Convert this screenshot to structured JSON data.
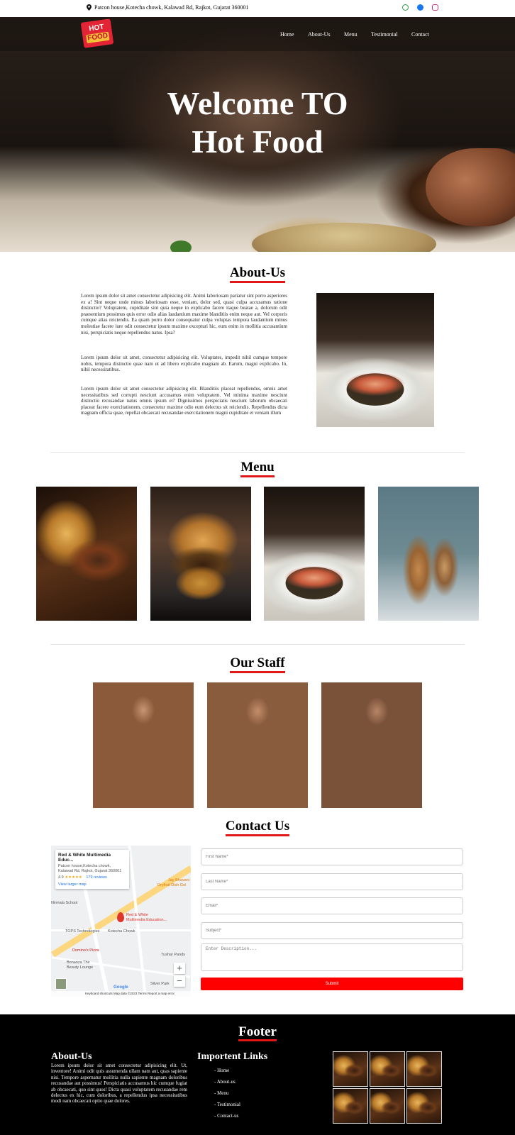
{
  "topbar": {
    "address": "Patcon house,Kotecha chowk, Kalawad Rd, Rajkot, Gujarat 360001",
    "socials": [
      {
        "icon": "whatsapp-icon",
        "color": "#25a244"
      },
      {
        "icon": "facebook-icon",
        "color": "#1877f2"
      },
      {
        "icon": "instagram-icon",
        "color": "#c13584"
      }
    ]
  },
  "nav": {
    "logo_line1": "HOT",
    "logo_line2": "FOOD",
    "items": [
      "Home",
      "About-Us",
      "Menu",
      "Testimonial",
      "Contact"
    ]
  },
  "hero": {
    "line1": "Welcome TO",
    "line2": "Hot Food"
  },
  "about": {
    "title": "About-Us",
    "paragraphs": [
      "Lorem ipsum dolor sit amet consectetur adipisicing elit. Animi laboriosam pariatur sint porro asperiores ex a! Sint neque unde minus laboriosam esse, veniam, dolor sed, quasi culpa accusamus ratione distinctio? Voluptatem, cupiditate sint quia neque in explicabo facere itaque beatae a, dolorum odit praesentium possimus quis error odio alias laudantium maxime blanditiis enim neque aut. Vel corporis cumque alias reiciendis. Ea quam porro dolor consequatur culpa voluptas tempora laudantium minus molestiae facere iure odit consectetur ipsum maxime excepturi hic, eum enim in mollitia accusantium nisi, perspiciatis neque repellendus natus. Ipsa?",
      "Lorem ipsum dolor sit amet, consectetur adipisicing elit. Voluptates, impedit nihil cumque tempore nobis, tempora distinctio quae nam ut ad libero explicabo magnam ab. Earum, magni explicabo. In, nihil necessitatibus.",
      "Lorem ipsum dolor sit amet consectetur adipisicing elit. Blanditiis placeat repellendus, omnis amet necessitatibus sed corrupti nesciunt accusamus enim voluptatem. Vel minima maxime nesciunt distinctio recusandae natus omnis ipsum et? Dignissimos perspiciatis nesciunt laborum obcaecati placeat facere exercitationem, consectetur maxime odio eum delectus sit reiciendis. Repellendus dicta magnam officia quae, repellat obcaecati recusandae exercitationem magni cupiditate et veniam illum"
    ]
  },
  "menu": {
    "title": "Menu"
  },
  "staff": {
    "title": "Our Staff"
  },
  "contact": {
    "title": "Contact Us",
    "map": {
      "place_name": "Red & White Multimedia Educ...",
      "place_addr1": "Patcon house,Kotecha chowk,",
      "place_addr2": "Kalawad Rd, Rajkot, Gujarat 360001",
      "rating": "4.9",
      "stars": "★★★★★",
      "reviews": "179 reviews",
      "larger_map": "View larger map",
      "pin_label1": "Red & White",
      "pin_label2": "Multimedia Education...",
      "labels": [
        "TOPS Technologies",
        "Domino's Pizza",
        "Bonanza The",
        "Beauty Lounge",
        "Tushar Pandy",
        "Jay Bhavani",
        "Dryfruit Dish Gol",
        "Kotecha Chowk",
        "Nirmala School",
        "Silver Park"
      ],
      "zoom_in": "+",
      "zoom_out": "−",
      "google": "Google",
      "footer_text": "Keyboard shortcuts    Map data ©2023    Terms    Report a map error"
    },
    "first_name_placeholder": "First Name*",
    "last_name_placeholder": "Last Name*",
    "email_placeholder": "Email*",
    "subject_placeholder": "Subject*",
    "description_placeholder": "Enter Description...",
    "submit_label": "Submit"
  },
  "footer": {
    "title": "Footer",
    "about_title": "About-Us",
    "about_text": "Lorem ipsum dolor sit amet consectetur adipisicing elit. Ut, inventore! Animi odit quis assumenda ullam nam aut, quas sapiente nisi. Tempore aspernatur mollitia nulla sapiente magnam doloribus recusandae aut possimus! Perspiciatis accusamus hic cumque fugiat ab obcaecati, quo sint quos! Dicta quasi voluptatem recusandae rem delectus ex hic, cum doloribus, a repellendus ipsa necessitatibus modi nam obcaecati optio quae dolores.",
    "links_title": "Importent Links",
    "links": [
      "- Home",
      "- About-us",
      "- Menu",
      "- Testimonial",
      "- Contact-us"
    ]
  }
}
